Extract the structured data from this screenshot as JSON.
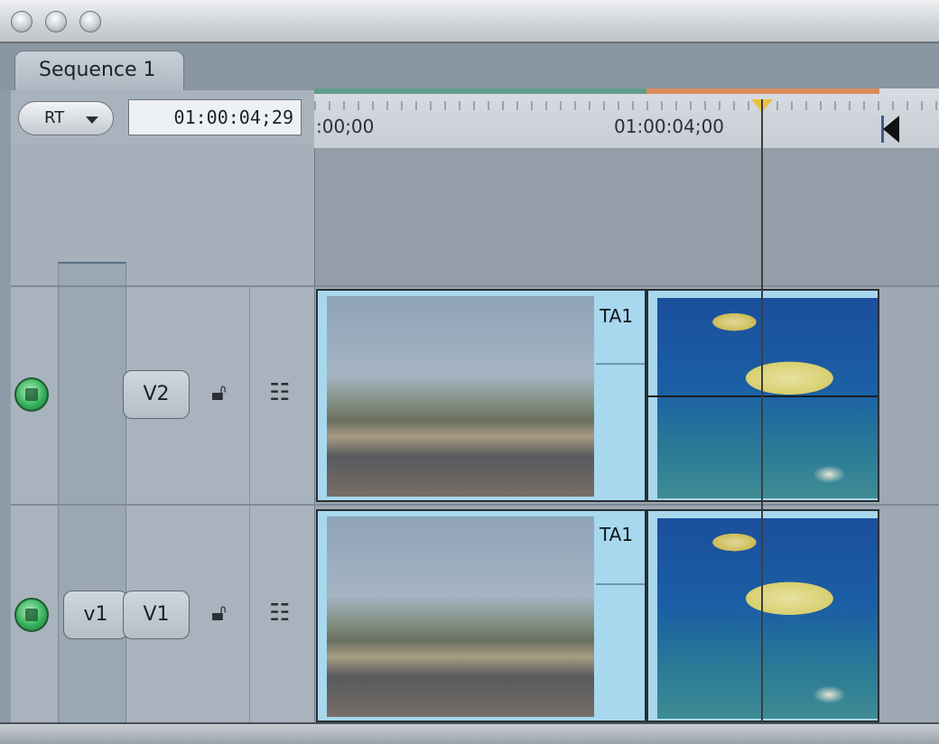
{
  "window": {
    "title_buttons": [
      "close-button",
      "minimize-button",
      "zoom-button"
    ]
  },
  "sequence_tab": {
    "label": "Sequence 1"
  },
  "controls": {
    "rt_menu": {
      "label": "RT"
    },
    "timecode": {
      "value": "01:00:04;29"
    }
  },
  "ruler": {
    "start_label": ":00;00",
    "mid_label": "01:00:04;00"
  },
  "tracks": [
    {
      "id": "V2",
      "destination_label": "",
      "source_label": "V2",
      "clips": [
        {
          "name": "TA1",
          "content": "airplane-landing"
        },
        {
          "name": "",
          "content": "fish-underwater"
        }
      ]
    },
    {
      "id": "V1",
      "destination_label": "v1",
      "source_label": "V1",
      "clips": [
        {
          "name": "TA1",
          "content": "airplane-landing"
        },
        {
          "name": "",
          "content": "fish-underwater"
        }
      ]
    }
  ],
  "colors": {
    "render_bar_green": "#5f9c8a",
    "render_bar_orange": "#d98a5a",
    "playhead": "#e8c23a",
    "clip_fill": "#a7d8ee",
    "visibility_on": "#38b25c"
  }
}
